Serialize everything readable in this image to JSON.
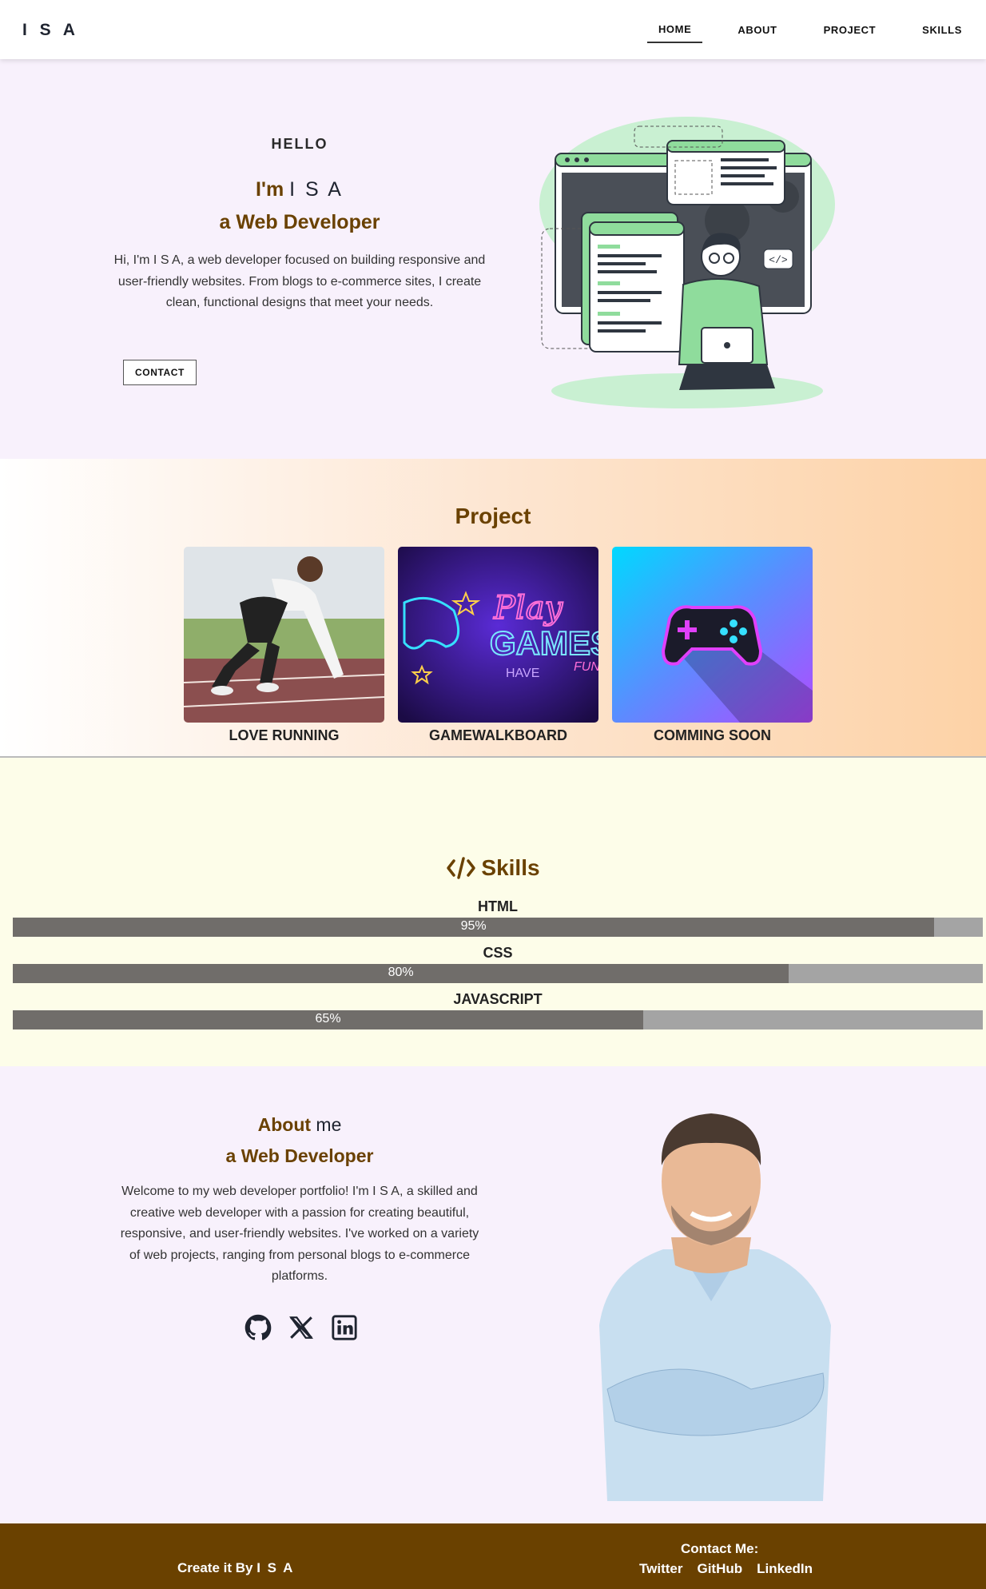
{
  "nav": {
    "logo": "I S A",
    "items": [
      {
        "label": "HOME",
        "active": true
      },
      {
        "label": "ABOUT",
        "active": false
      },
      {
        "label": "PROJECT",
        "active": false
      },
      {
        "label": "SKILLS",
        "active": false
      }
    ]
  },
  "hero": {
    "greeting": "HELLO",
    "im_prefix": "I'm",
    "name": "I S A",
    "role": "a Web Developer",
    "intro": "Hi, I'm I S A, a web developer focused on building responsive and user-friendly websites. From blogs to e-commerce sites, I create clean, functional designs that meet your needs.",
    "contact_label": "CONTACT",
    "code_tag": "</>"
  },
  "projects": {
    "title": "Project",
    "items": [
      {
        "caption": "LOVE RUNNING"
      },
      {
        "caption": "GAMEWALKBOARD",
        "sign_line1": "Play",
        "sign_line2": "GAMES",
        "sign_line3": "HAVE",
        "sign_line4": "FUN"
      },
      {
        "caption": "COMMING SOON"
      }
    ]
  },
  "skills": {
    "title": "Skills",
    "items": [
      {
        "name": "HTML",
        "percent_label": "95%",
        "level": 95
      },
      {
        "name": "CSS",
        "percent_label": "80%",
        "level": 80
      },
      {
        "name": "JAVASCRIPT",
        "percent_label": "65%",
        "level": 65
      }
    ]
  },
  "about": {
    "heading_strong": "About",
    "heading_rest": "me",
    "role": "a Web Developer",
    "text": "Welcome to my web developer portfolio! I'm I S A, a skilled and creative web developer with a passion for creating beautiful, responsive, and user-friendly websites. I've worked on a variety of web projects, ranging from personal blogs to e-commerce platforms.",
    "socials": [
      "github-icon",
      "x-twitter-icon",
      "linkedin-icon"
    ]
  },
  "footer": {
    "created_prefix": "Create it By",
    "created_name": "I S A",
    "contact_title": "Contact Me:",
    "links": [
      "Twitter",
      "GitHub",
      "LinkedIn"
    ]
  },
  "colors": {
    "accent_brown": "#6a4100",
    "hero_bg": "#f8f1fc",
    "skills_bg": "#fdfde9",
    "bar_fill": "#706d6a",
    "bar_track": "#a4a4a4",
    "illustration_green": "#8fdc9c"
  }
}
